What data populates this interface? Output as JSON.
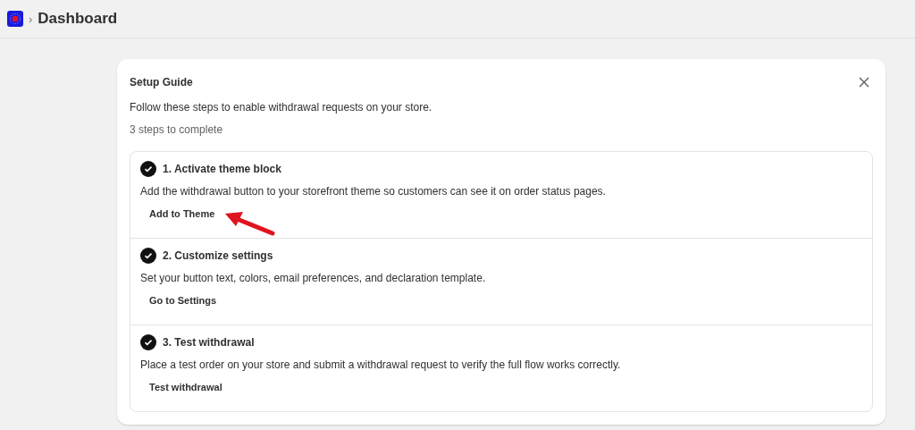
{
  "breadcrumb": {
    "separator": "›",
    "title": "Dashboard"
  },
  "setup_guide": {
    "title": "Setup Guide",
    "description": "Follow these steps to enable withdrawal requests on your store.",
    "progress": "3 steps to complete",
    "steps": [
      {
        "title": "1. Activate theme block",
        "description": "Add the withdrawal button to your storefront theme so customers can see it on order status pages.",
        "action": "Add to Theme",
        "checked": true,
        "annotated": true
      },
      {
        "title": "2. Customize settings",
        "description": "Set your button text, colors, email preferences, and declaration template.",
        "action": "Go to Settings",
        "checked": true,
        "annotated": false
      },
      {
        "title": "3. Test withdrawal",
        "description": "Place a test order on your store and submit a withdrawal request to verify the full flow works correctly.",
        "action": "Test withdrawal",
        "checked": true,
        "annotated": false
      }
    ]
  }
}
